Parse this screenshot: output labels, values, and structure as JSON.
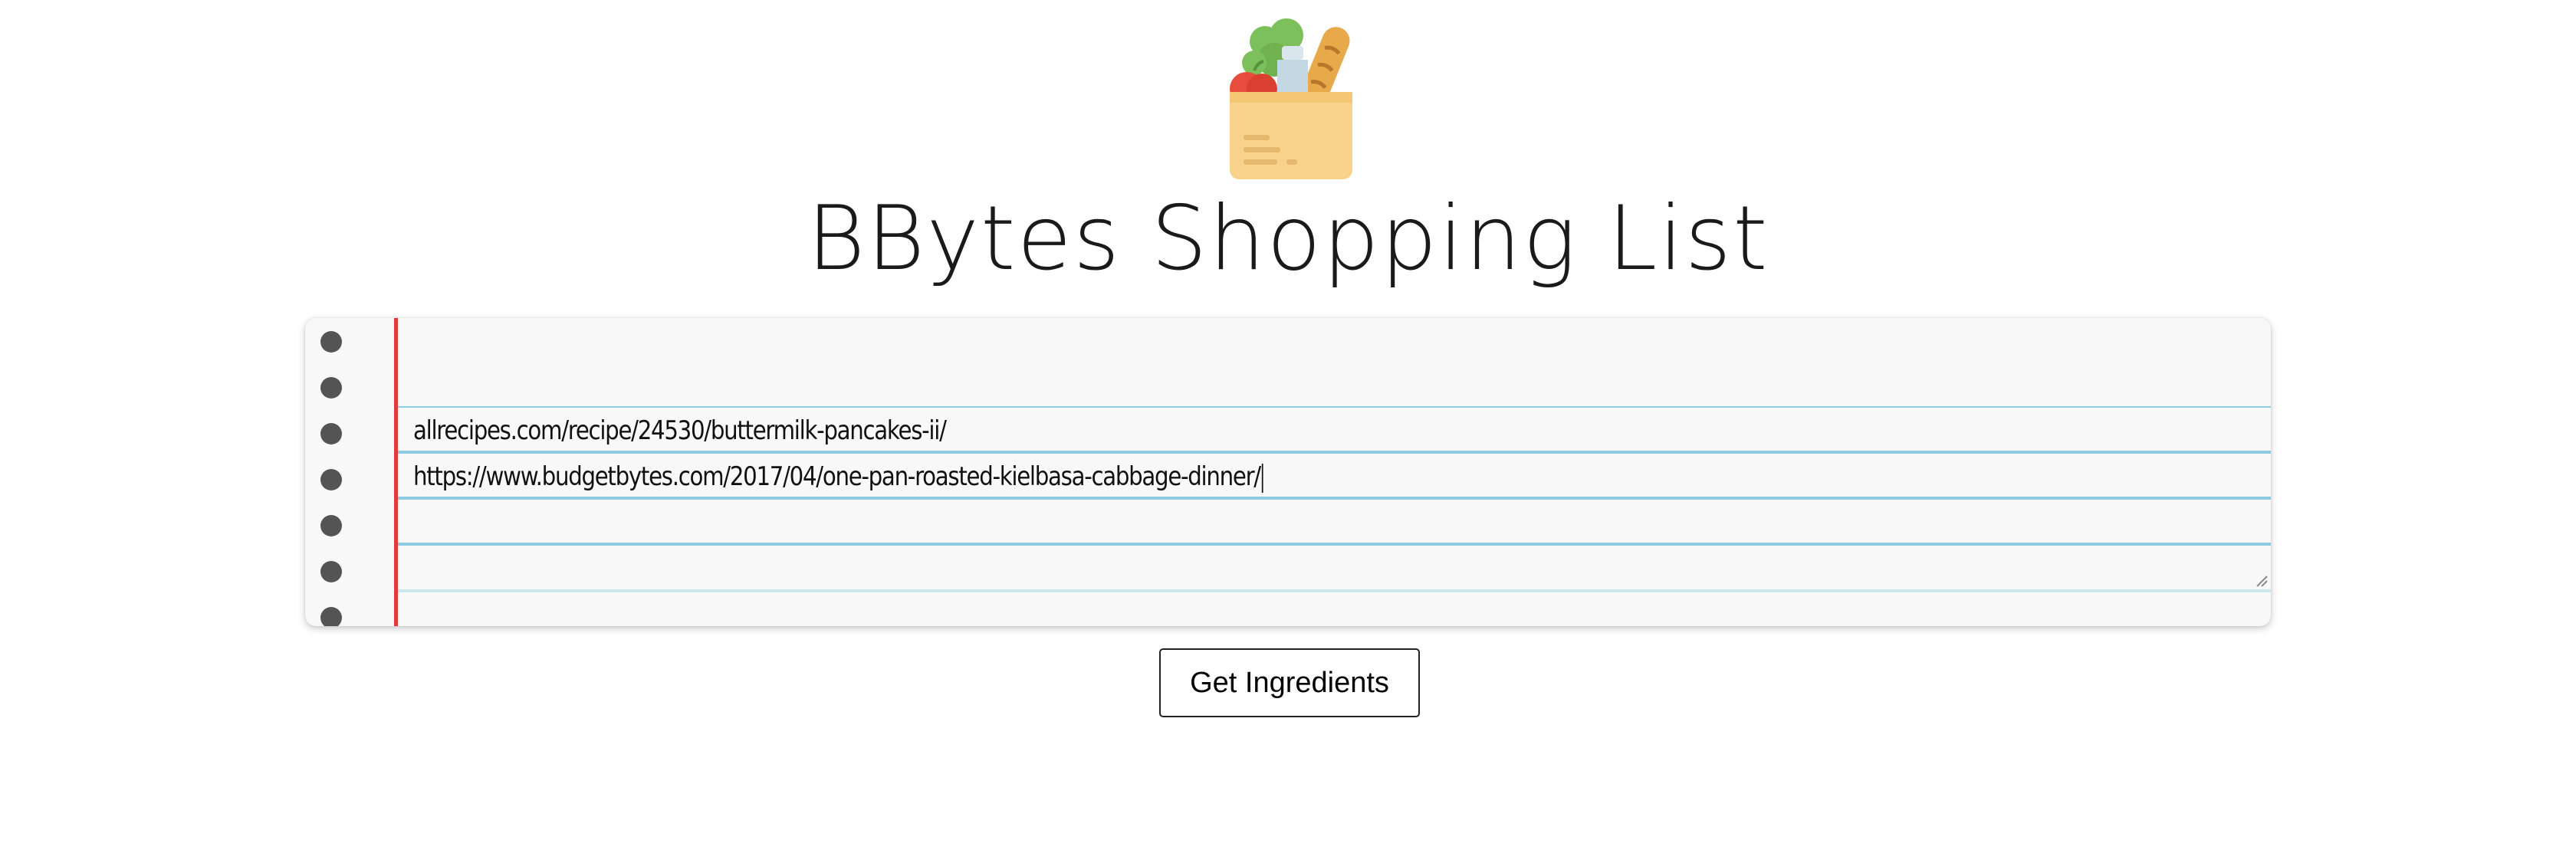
{
  "logo": {
    "icon": "grocery-bag-icon"
  },
  "page_title": "BBytes Shopping List",
  "recipe_input": {
    "lines": [
      "allrecipes.com/recipe/24530/buttermilk-pancakes-ii/",
      "https://www.budgetbytes.com/2017/04/one-pan-roasted-kielbasa-cabbage-dinner/"
    ]
  },
  "submit_button": {
    "label": "Get Ingredients"
  },
  "colors": {
    "margin_line": "#e0393e",
    "ruled_line": "#8fcbe0",
    "hole": "#545454",
    "paper": "#f8f8f8"
  }
}
